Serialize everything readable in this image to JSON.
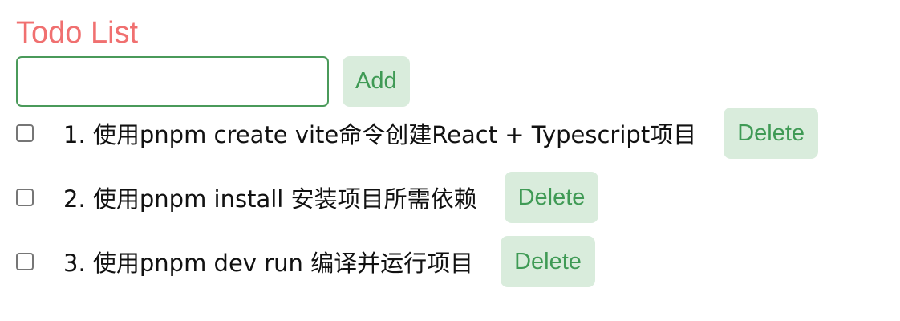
{
  "app": {
    "title": "Todo List"
  },
  "add_form": {
    "input_value": "",
    "input_placeholder": "",
    "add_label": "Add"
  },
  "todos": [
    {
      "text": "1. 使用pnpm create vite命令创建React + Typescript项目",
      "checked": false,
      "delete_label": "Delete"
    },
    {
      "text": "2. 使用pnpm install 安装项目所需依赖",
      "checked": false,
      "delete_label": "Delete"
    },
    {
      "text": "3. 使用pnpm dev run 编译并运行项目",
      "checked": false,
      "delete_label": "Delete"
    }
  ],
  "colors": {
    "title": "#f07070",
    "button_bg": "#d9ecdc",
    "button_text": "#3f9a55",
    "input_border": "#4a9a5a"
  }
}
